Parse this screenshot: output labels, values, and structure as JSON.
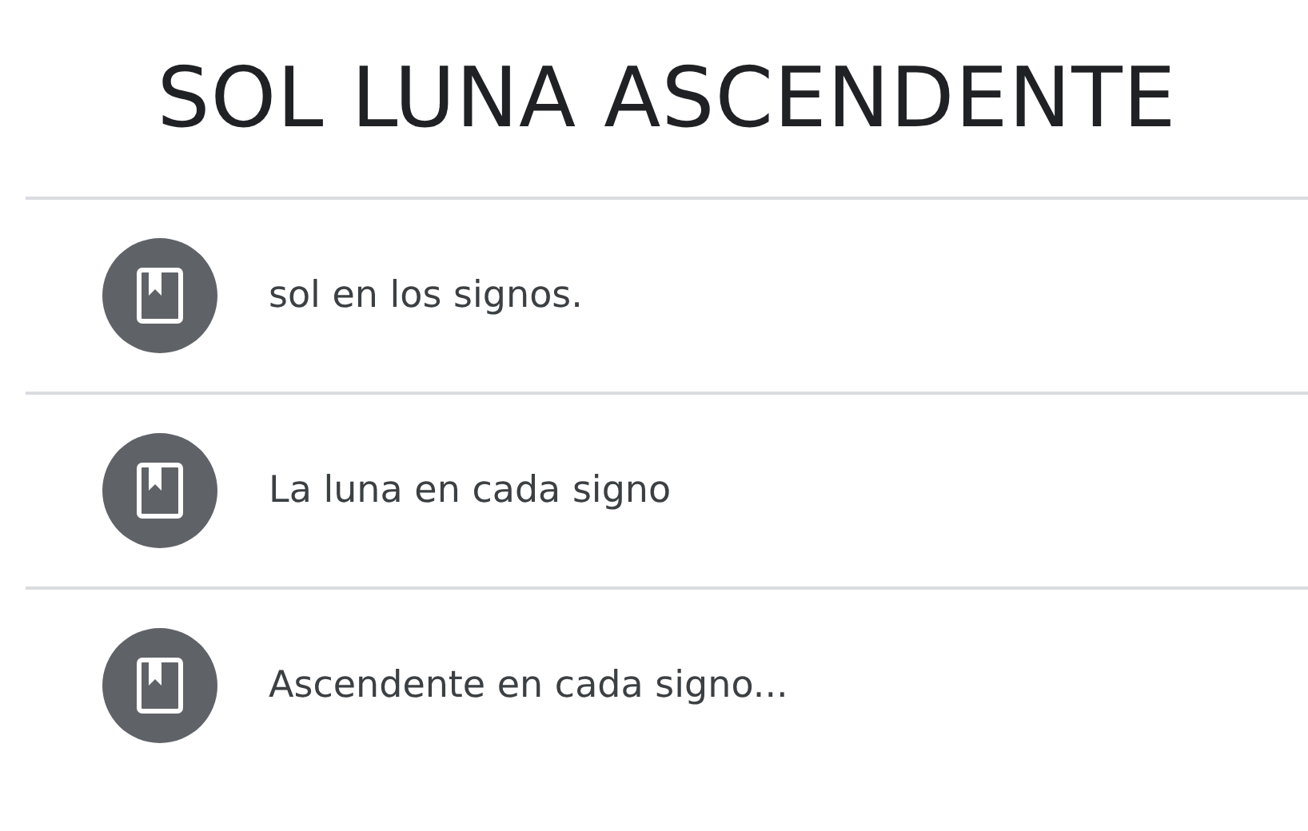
{
  "title": "SOL LUNA ASCENDENTE",
  "items": [
    {
      "label": "sol en los signos."
    },
    {
      "label": "La luna en cada signo"
    },
    {
      "label": "Ascendente en cada signo..."
    }
  ]
}
